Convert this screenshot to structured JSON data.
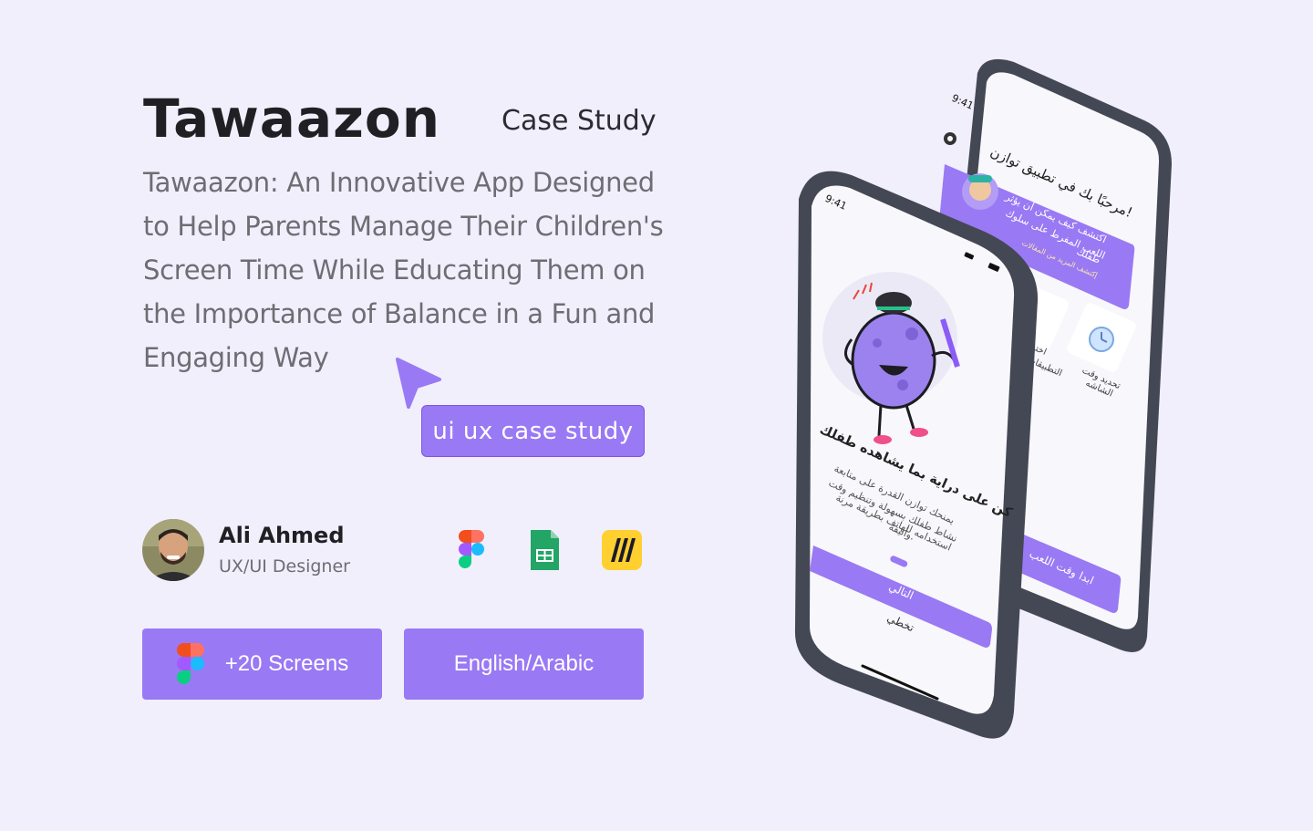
{
  "header": {
    "title": "Tawaazon",
    "subtitle": "Case Study"
  },
  "description": "Tawaazon: An Innovative App Designed to Help Parents Manage Their Children's Screen Time While Educating Them on the Importance of Balance in a Fun and Engaging Way",
  "cta_tag": "ui ux case study",
  "author": {
    "name": "Ali Ahmed",
    "role": "UX/UI Designer"
  },
  "tools": [
    "figma-icon",
    "google-sheets-icon",
    "miro-icon"
  ],
  "buttons": {
    "screens_label": "+20 Screens",
    "language_label": "English/Arabic"
  },
  "phone_back": {
    "status_time": "9:41",
    "greeting": "مرحبًا بك في تطبيق توازن!",
    "card_text_1": "اكتشف كيف يمكن أن يؤثر",
    "card_text_2": "اللعب المفرط على سلوك",
    "card_text_3": "طفلك",
    "card_link": "إكتشف المزيد من المقالات",
    "tile_1": "تحديد وقت",
    "tile_1b": "الشاشه",
    "tile_2": "اختر",
    "tile_2b": "التطبيقات",
    "start_button": "ابدا وقت اللعب"
  },
  "phone_front": {
    "status_time": "9:41",
    "headline": "كن على دراية بما يشاهده طفلك",
    "body_1": "يمنحك توازن القدرة على متابعة",
    "body_2": "نشاط طفلك بسهولة وتنظيم وقت",
    "body_3": "استخدامه للهاتف بطريقة مرنة",
    "body_4": "وأنيقة.",
    "next_button": "التالي",
    "skip_link": "تخطي"
  },
  "colors": {
    "background": "#f1effc",
    "accent": "#9979f4",
    "phone_frame": "#454a56"
  }
}
